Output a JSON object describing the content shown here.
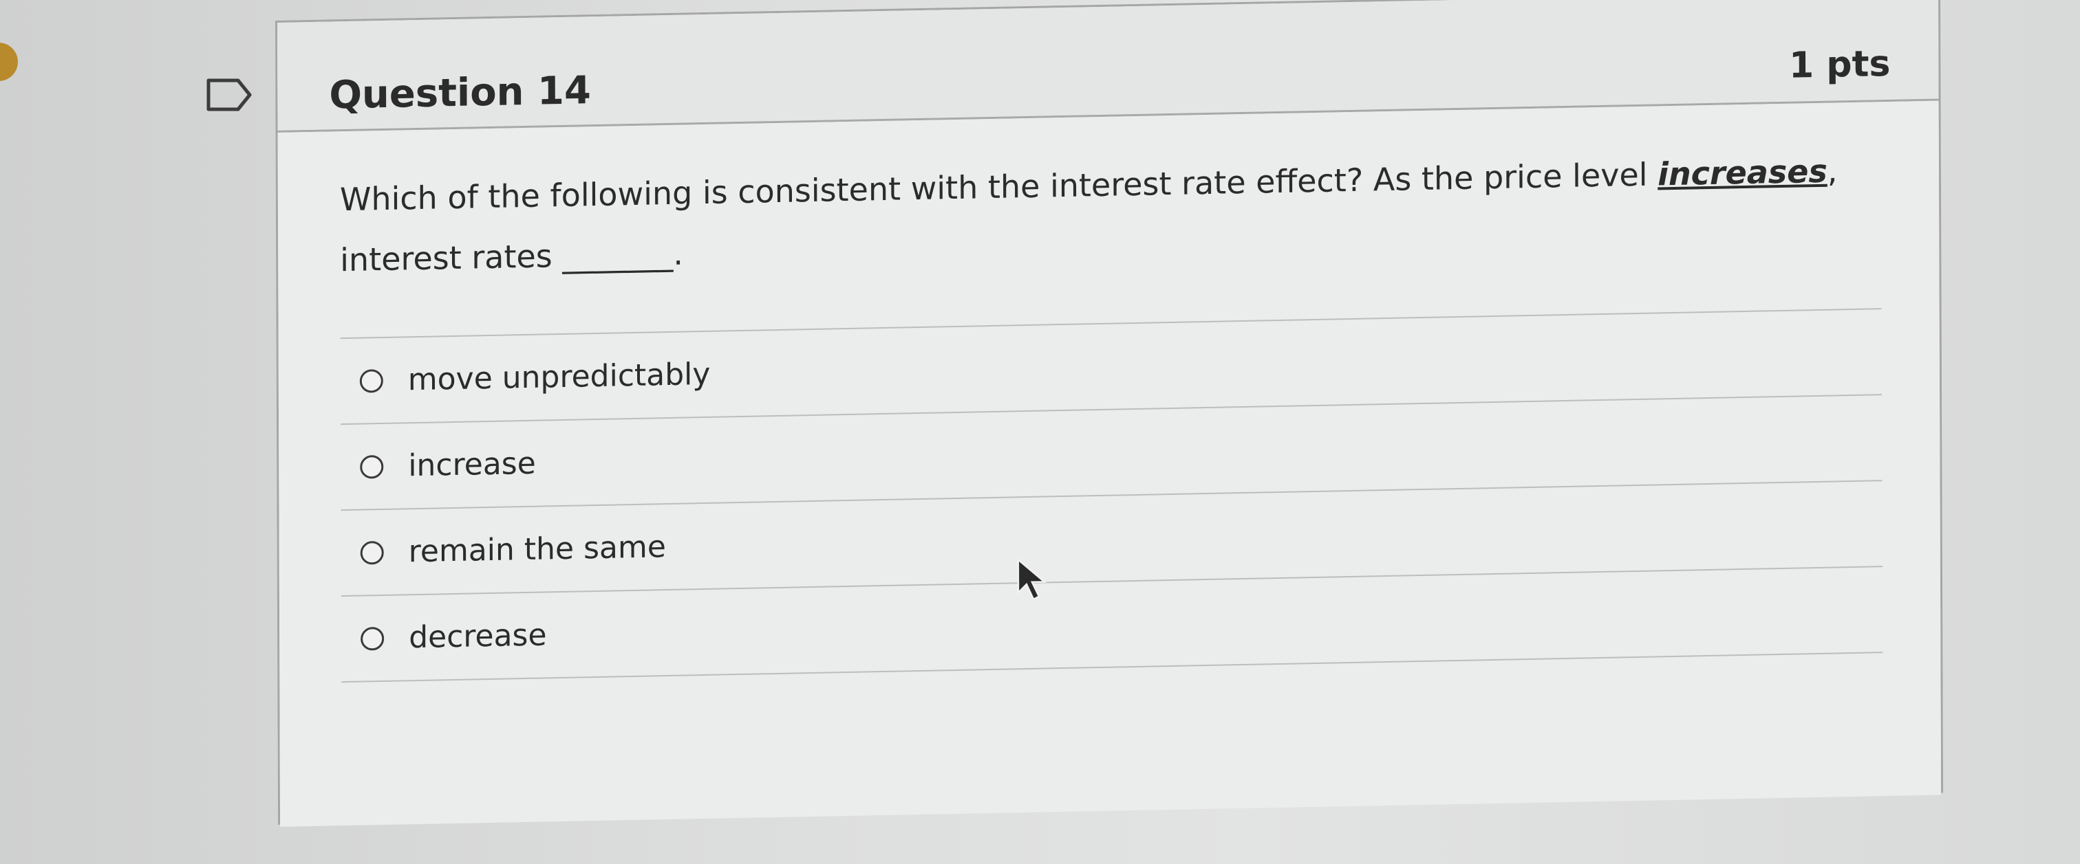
{
  "question": {
    "title": "Question 14",
    "points": "1 pts",
    "text_before": "Which of the following is consistent with the interest rate effect? As the price level ",
    "emphasis": "increases",
    "text_after": ", interest rates _______."
  },
  "answers": [
    {
      "label": "move unpredictably"
    },
    {
      "label": "increase"
    },
    {
      "label": "remain the same"
    },
    {
      "label": "decrease"
    }
  ],
  "icons": {
    "flag": "flag-icon",
    "cursor": "mouse-cursor-icon",
    "radio": "radio-icon"
  },
  "colors": {
    "card_border": "#a5a5a5",
    "text": "#2b2b2b",
    "accent_dot": "#b88a2b"
  }
}
